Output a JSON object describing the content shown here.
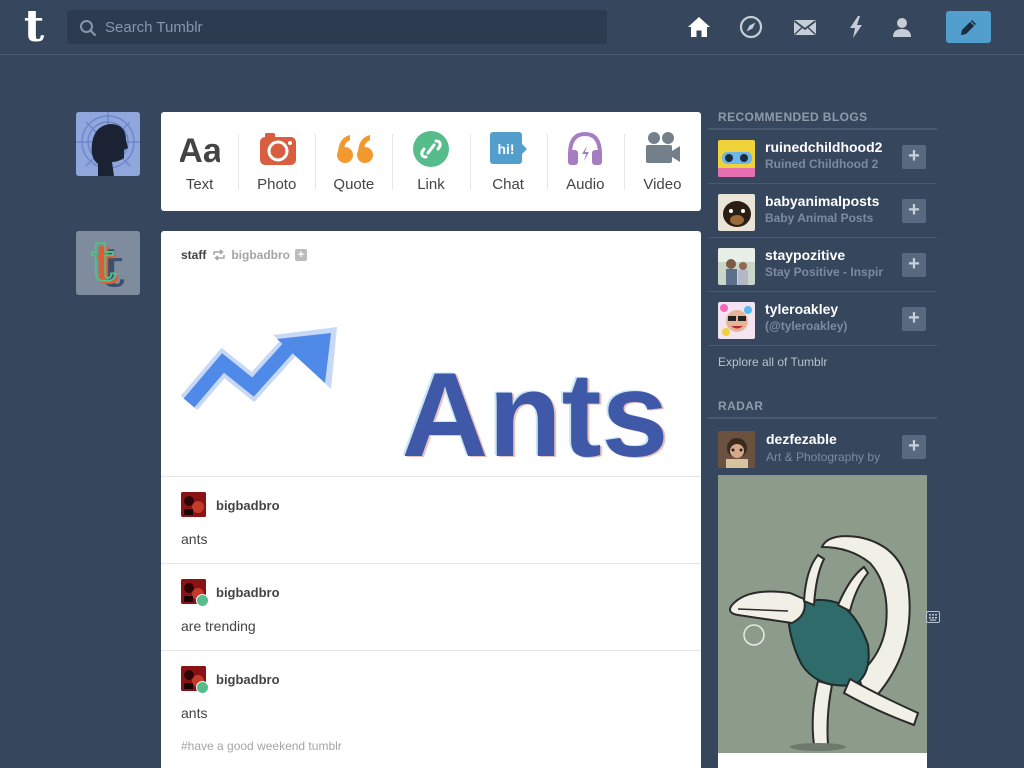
{
  "header": {
    "logo": "t",
    "search_placeholder": "Search Tumblr",
    "nav": [
      "home-icon",
      "explore-icon",
      "inbox-icon",
      "activity-icon",
      "account-icon"
    ],
    "compose_icon": "pencil-icon"
  },
  "post_types": [
    {
      "label": "Text",
      "icon": "text-icon",
      "color": "#444444",
      "glyph": "Aa"
    },
    {
      "label": "Photo",
      "icon": "photo-icon",
      "color": "#d95e40"
    },
    {
      "label": "Quote",
      "icon": "quote-icon",
      "color": "#f2992e"
    },
    {
      "label": "Link",
      "icon": "link-icon",
      "color": "#56bc8a"
    },
    {
      "label": "Chat",
      "icon": "chat-icon",
      "color": "#529ecc",
      "glyph": "hi!"
    },
    {
      "label": "Audio",
      "icon": "audio-icon",
      "color": "#a77dc2"
    },
    {
      "label": "Video",
      "icon": "video-icon",
      "color": "#748089"
    }
  ],
  "post": {
    "author": "staff",
    "reblogged_from": "bigbadbro",
    "image_text": "Ants",
    "reblogs": [
      {
        "name": "bigbadbro",
        "text": "ants",
        "badge": false
      },
      {
        "name": "bigbadbro",
        "text": "are trending",
        "badge": true
      },
      {
        "name": "bigbadbro",
        "text": "ants",
        "badge": true
      }
    ],
    "tags": "#have a good weekend tumblr"
  },
  "sidebar": {
    "recommended_title": "RECOMMENDED BLOGS",
    "blogs": [
      {
        "name": "ruinedchildhood2",
        "subtitle": "Ruined Childhood 2"
      },
      {
        "name": "babyanimalposts",
        "subtitle": "Baby Animal Posts"
      },
      {
        "name": "staypozitive",
        "subtitle": "Stay Positive - Inspir"
      },
      {
        "name": "tyleroakley",
        "subtitle": "(@tyleroakley)"
      }
    ],
    "explore": "Explore all of Tumblr",
    "radar_title": "RADAR",
    "radar": {
      "name": "dezfezable",
      "subtitle": "Art & Photography by"
    }
  },
  "colors": {
    "background": "#36465d",
    "accent": "#529ecc"
  }
}
